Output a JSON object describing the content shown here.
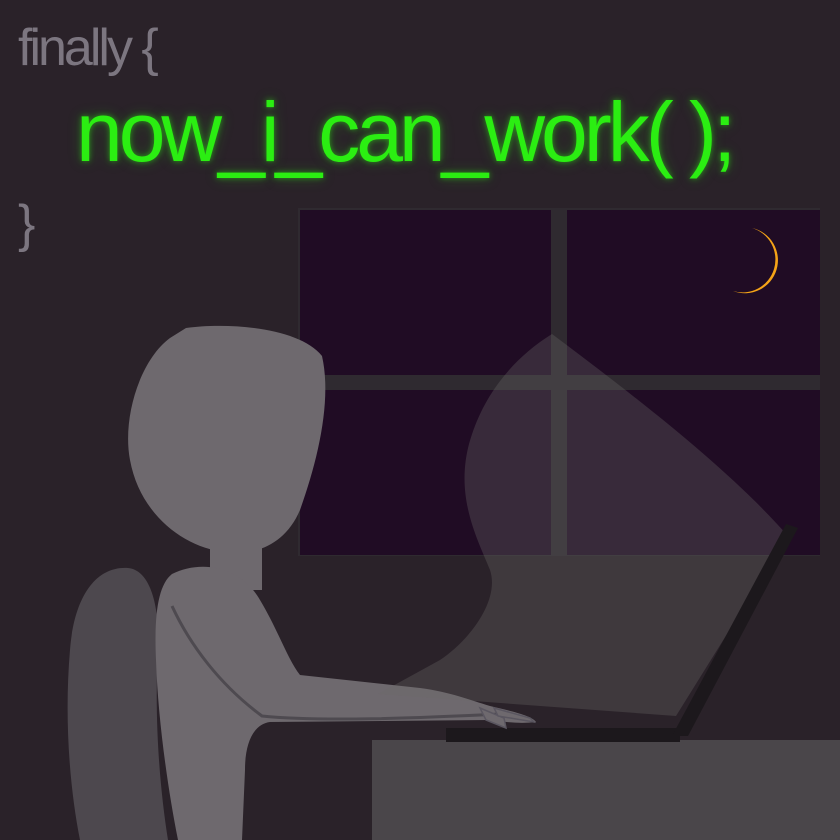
{
  "code": {
    "keyword_line": "finally {",
    "call_line": "now_i_can_work( );",
    "closing_line": "}"
  },
  "colors": {
    "background": "#2a2229",
    "window_glass": "#200c24",
    "window_frame": "#2f2a30",
    "moon": "#f5a417",
    "code_highlight": "#2bee12",
    "code_muted": "#7c7680",
    "person": "#6e696e",
    "chair": "#4d484e",
    "desk": "#4a464a",
    "laptop": "#1c181c"
  },
  "icons": [
    "moon-icon"
  ]
}
